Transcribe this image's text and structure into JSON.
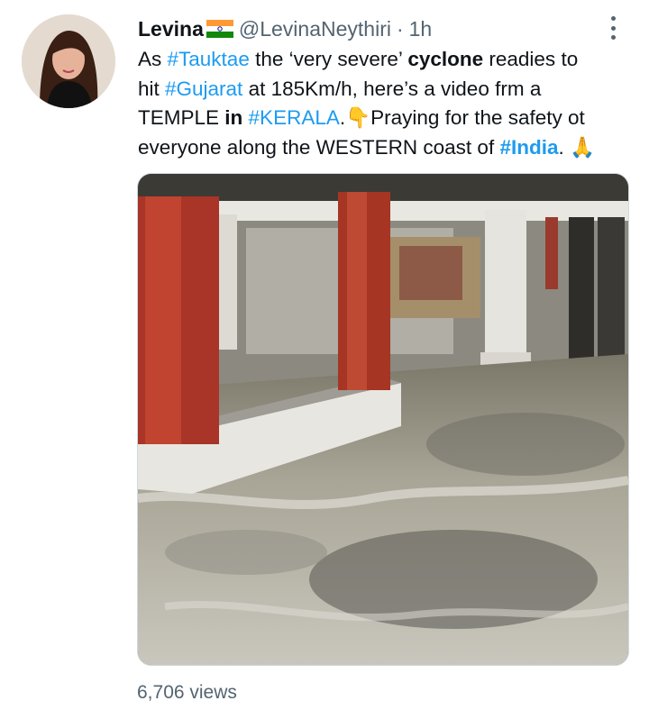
{
  "tweet": {
    "author_name": "Levina",
    "handle": "@LevinaNeythiri",
    "separator": "·",
    "time": "1h",
    "text": {
      "l1_a": "As ",
      "l1_tag": "#Tauktae",
      "l1_b": " the ‘very severe’ ",
      "l1_bold": "cyclone",
      "l1_c": " readies to",
      "l2_a": "hit ",
      "l2_tag": "#Gujarat",
      "l2_b": " at 185Km/h, here’s a video frm a",
      "l3_a": "TEMPLE ",
      "l3_bold": "in",
      "l3_b": " ",
      "l3_tag": "#KERALA",
      "l3_c": ".",
      "l3_emoji": "👇",
      "l3_d": "Praying for the safety ot",
      "l4_a": "everyone along the WESTERN coast of ",
      "l4_tag": "#India",
      "l4_b": ". ",
      "l4_emoji": "🙏"
    },
    "views": "6,706 views"
  },
  "icons": {
    "flag": "india-flag-icon",
    "more": "more-vertical-icon"
  },
  "colors": {
    "link": "#1d9bf0",
    "secondary_text": "#536471",
    "flag_saffron": "#ff9933",
    "flag_white": "#ffffff",
    "flag_green": "#138808"
  }
}
